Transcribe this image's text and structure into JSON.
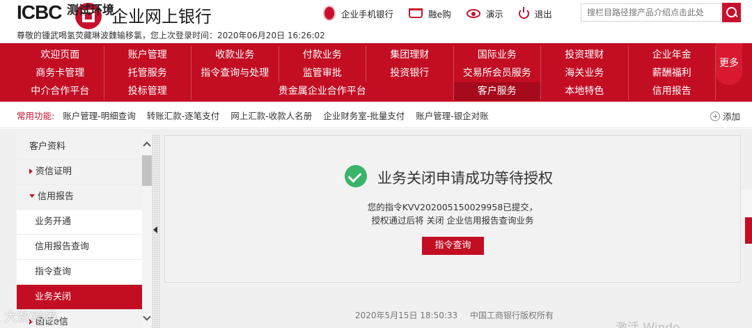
{
  "header": {
    "logo_text": "ICBC",
    "env_tag": "测试环境",
    "bank_title": "企业网上银行",
    "welcome_text": "尊敬的锺武喝氢荧藏琳波魏输移氯，您上次登录时间：2020年06月20日 16:26:02",
    "top_links": [
      {
        "label": "企业手机银行",
        "icon": "mobile-bank-icon"
      },
      {
        "label": "融e购",
        "icon": "cart-icon"
      },
      {
        "label": "演示",
        "icon": "demo-eye-icon"
      },
      {
        "label": "退出",
        "icon": "power-icon"
      }
    ],
    "search_placeholder": "搜栏目路径搜产品介绍点击此处"
  },
  "nav": {
    "rows": [
      [
        "欢迎页面",
        "账户管理",
        "收款业务",
        "付款业务",
        "集团理财",
        "国际业务",
        "投资理财",
        "企业年金"
      ],
      [
        "商务卡管理",
        "托管服务",
        "指令查询与处理",
        "监管审批",
        "投资银行",
        "交易所会员服务",
        "海关业务",
        "薪酬福利"
      ],
      [
        "中介合作平台",
        "投标管理",
        "贵金属企业合作平台",
        "客户服务",
        "本地特色",
        "信用报告"
      ]
    ],
    "active": "客户服务",
    "more_label": "更多"
  },
  "quick": {
    "label": "常用功能:",
    "items": [
      "账户管理-明细查询",
      "转账汇款-逐笔支付",
      "网上汇款-收款人名册",
      "企业财务室-批量支付",
      "账户管理-银企对账"
    ],
    "add_label": "添加"
  },
  "sidebar": {
    "header": "客户资料",
    "items": [
      {
        "label": "资信证明",
        "type": "group-collapsed"
      },
      {
        "label": "信用报告",
        "type": "group-expanded"
      },
      {
        "label": "业务开通",
        "type": "sub"
      },
      {
        "label": "信用报告查询",
        "type": "sub"
      },
      {
        "label": "指令查询",
        "type": "sub"
      },
      {
        "label": "业务关闭",
        "type": "sub-active"
      },
      {
        "label": "函证e信",
        "type": "group-collapsed"
      }
    ]
  },
  "result": {
    "title": "业务关闭申请成功等待授权",
    "line1": "您的指令KVV202005150029958已提交，",
    "line2": "授权通过后将 关闭 企业信用报告查询业务",
    "button_label": "指令查询",
    "status_color": "#3cb36b"
  },
  "footer": {
    "datetime": "2020年5月15日 18:50:33",
    "copyright": "中国工商银行版权所有"
  },
  "watermarks": {
    "left": "大数跨境",
    "right": "激活 Windo"
  },
  "colors": {
    "brand_red": "#c30d23",
    "accent_green": "#3cb36b"
  }
}
